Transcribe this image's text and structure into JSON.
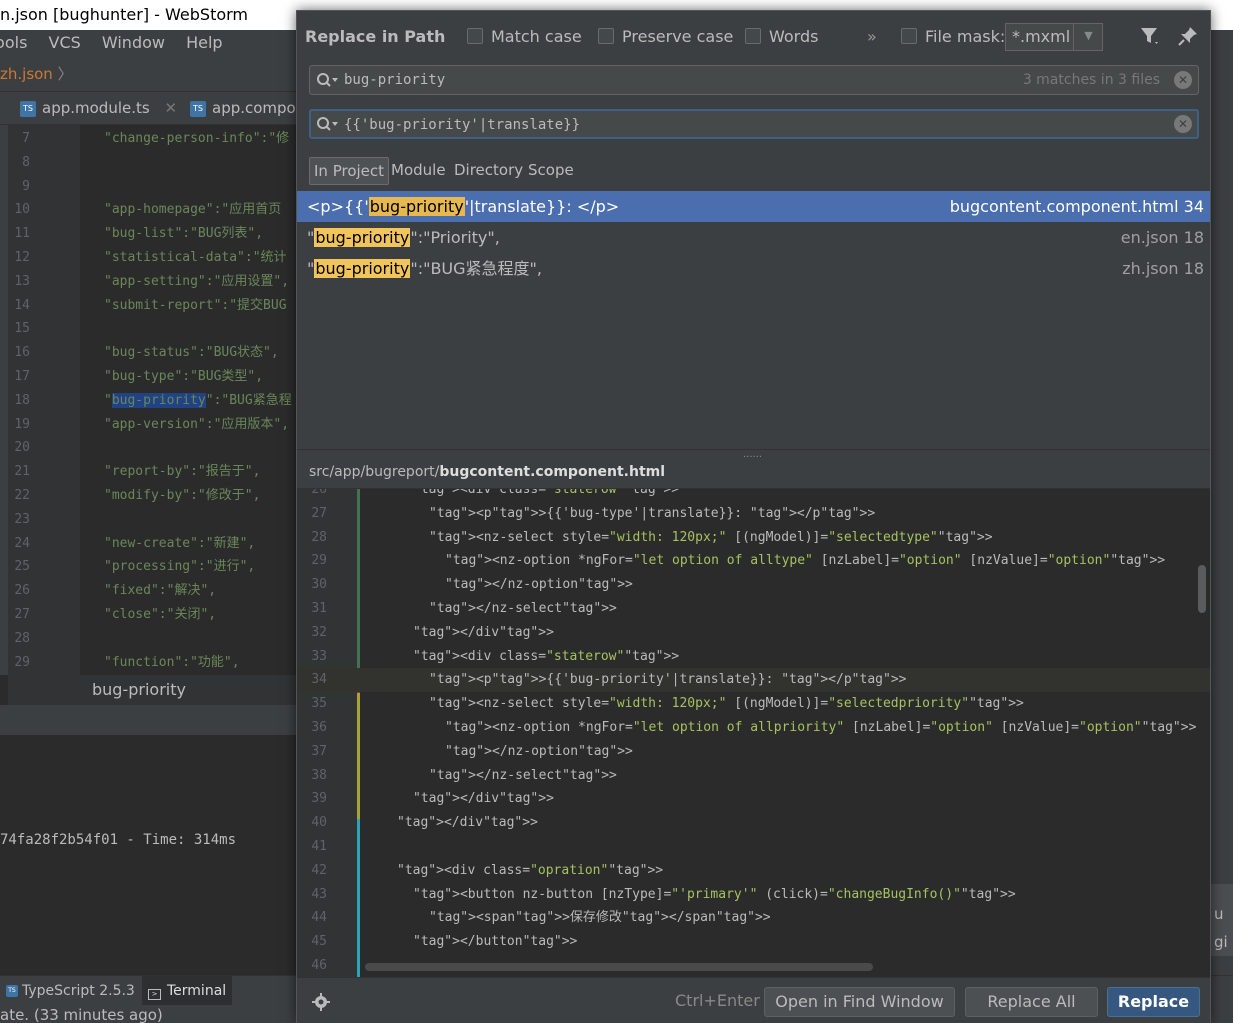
{
  "ide": {
    "window_title": "n.json [bughunter] - WebStorm",
    "menu": [
      "Tools",
      "VCS",
      "Window",
      "Help"
    ],
    "nav_file": "zh.json",
    "tabs": [
      "app.module.ts",
      "app.compon"
    ],
    "ts_badge": "TS",
    "editor_lines": [
      {
        "n": "7",
        "code": "\"change-person-info\":\"修"
      },
      {
        "n": "8",
        "code": ""
      },
      {
        "n": "9",
        "code": ""
      },
      {
        "n": "10",
        "code": "\"app-homepage\":\"应用首页"
      },
      {
        "n": "11",
        "code": "\"bug-list\":\"BUG列表\","
      },
      {
        "n": "12",
        "code": "\"statistical-data\":\"统计"
      },
      {
        "n": "13",
        "code": "\"app-setting\":\"应用设置\","
      },
      {
        "n": "14",
        "code": "\"submit-report\":\"提交BUG"
      },
      {
        "n": "15",
        "code": ""
      },
      {
        "n": "16",
        "code": "\"bug-status\":\"BUG状态\","
      },
      {
        "n": "17",
        "code": "\"bug-type\":\"BUG类型\","
      },
      {
        "n": "18",
        "code": "\"bug-priority\":\"BUG紧急程"
      },
      {
        "n": "19",
        "code": "\"app-version\":\"应用版本\","
      },
      {
        "n": "20",
        "code": ""
      },
      {
        "n": "21",
        "code": "\"report-by\":\"报告于\","
      },
      {
        "n": "22",
        "code": "\"modify-by\":\"修改于\","
      },
      {
        "n": "23",
        "code": ""
      },
      {
        "n": "24",
        "code": "\"new-create\":\"新建\","
      },
      {
        "n": "25",
        "code": "\"processing\":\"进行\","
      },
      {
        "n": "26",
        "code": "\"fixed\":\"解决\","
      },
      {
        "n": "27",
        "code": "\"close\":\"关闭\","
      },
      {
        "n": "28",
        "code": ""
      },
      {
        "n": "29",
        "code": "\"function\":\"功能\","
      }
    ],
    "breadcrumb_bottom": "bug-priority",
    "terminal_output": "74fa28f2b54f01 - Time: 314ms",
    "tool_tabs": [
      "TypeScript 2.5.3",
      "Terminal"
    ],
    "status_text": "ate. (33 minutes ago)",
    "notification_text": "ugi is r"
  },
  "dialog": {
    "title": "Replace in Path",
    "options": {
      "match_case": "Match case",
      "preserve_case": "Preserve case",
      "words": "Words",
      "more": "»",
      "file_mask": "File mask:",
      "file_mask_value": "*.mxml"
    },
    "search": {
      "value": "bug-priority",
      "count": "3 matches in 3 files"
    },
    "replace": {
      "value": "{{'bug-priority'|translate}}"
    },
    "scopes": [
      "In Project",
      "Module",
      "Directory",
      "Scope"
    ],
    "active_scope": "In Project",
    "results": [
      {
        "pre": "<p>{{'",
        "match": "bug-priority",
        "post": "'|translate}}: </p>",
        "file": "bugcontent.component.html 34",
        "selected": true
      },
      {
        "pre": "\"",
        "match": "bug-priority",
        "post": "\":\"Priority\",",
        "file": "en.json 18",
        "selected": false
      },
      {
        "pre": "\"",
        "match": "bug-priority",
        "post": "\":\"BUG紧急程度\",",
        "file": "zh.json 18",
        "selected": false
      }
    ],
    "preview_path_prefix": "src/app/bugreport/",
    "preview_path_file": "bugcontent.component.html",
    "preview_lines": [
      {
        "n": "26",
        "indent": 1,
        "code": "<div class=\"staterow\">"
      },
      {
        "n": "27",
        "indent": 2,
        "code": "<p>{{'bug-type'|translate}}: </p>"
      },
      {
        "n": "28",
        "indent": 2,
        "code": "<nz-select style=\"width: 120px;\" [(ngModel)]=\"selectedtype\">"
      },
      {
        "n": "29",
        "indent": 3,
        "code": "<nz-option *ngFor=\"let option of alltype\" [nzLabel]=\"option\" [nzValue]=\"option\">"
      },
      {
        "n": "30",
        "indent": 3,
        "code": "</nz-option>"
      },
      {
        "n": "31",
        "indent": 2,
        "code": "</nz-select>"
      },
      {
        "n": "32",
        "indent": 1,
        "code": "</div>"
      },
      {
        "n": "33",
        "indent": 1,
        "code": "<div class=\"staterow\">"
      },
      {
        "n": "34",
        "indent": 2,
        "code": "<p>{{'bug-priority'|translate}}: </p>"
      },
      {
        "n": "35",
        "indent": 2,
        "code": "<nz-select style=\"width: 120px;\" [(ngModel)]=\"selectedpriority\">"
      },
      {
        "n": "36",
        "indent": 3,
        "code": "<nz-option *ngFor=\"let option of allpriority\" [nzLabel]=\"option\" [nzValue]=\"option\">"
      },
      {
        "n": "37",
        "indent": 3,
        "code": "</nz-option>"
      },
      {
        "n": "38",
        "indent": 2,
        "code": "</nz-select>"
      },
      {
        "n": "39",
        "indent": 1,
        "code": "</div>"
      },
      {
        "n": "40",
        "indent": 0,
        "code": "</div>"
      },
      {
        "n": "41",
        "indent": 0,
        "code": ""
      },
      {
        "n": "42",
        "indent": 0,
        "code": "<div class=\"opration\">"
      },
      {
        "n": "43",
        "indent": 1,
        "code": "<button nz-button [nzType]=\"'primary'\" (click)=\"changeBugInfo()\">"
      },
      {
        "n": "44",
        "indent": 2,
        "code": "<span>保存修改</span>"
      },
      {
        "n": "45",
        "indent": 1,
        "code": "</button>"
      },
      {
        "n": "46",
        "indent": 0,
        "code": ""
      }
    ],
    "footer": {
      "shortcut": "Ctrl+Enter",
      "open_in_find": "Open in Find Window",
      "replace_all": "Replace All",
      "replace": "Replace"
    }
  },
  "colors": {
    "selection": "#4b6eaf",
    "match_highlight": "#f2c55c",
    "primary_button": "#365880",
    "editor_bg": "#2b2b2b",
    "panel_bg": "#3c3f41"
  }
}
